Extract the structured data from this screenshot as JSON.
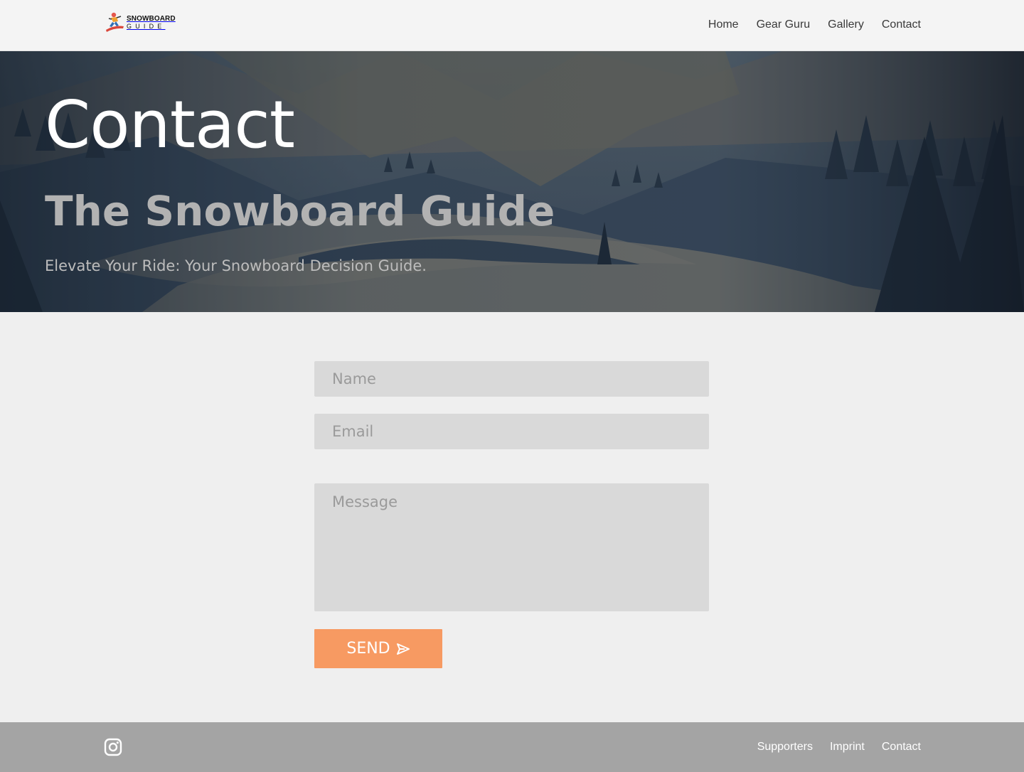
{
  "header": {
    "logo": {
      "line1": "SNOWBOARD",
      "line2": "GUIDE"
    },
    "nav": [
      {
        "label": "Home"
      },
      {
        "label": "Gear Guru"
      },
      {
        "label": "Gallery"
      },
      {
        "label": "Contact"
      }
    ]
  },
  "hero": {
    "title": "Contact",
    "subtitle": "The Snowboard Guide",
    "tagline": "Elevate Your Ride: Your Snowboard Decision Guide."
  },
  "form": {
    "name_placeholder": "Name",
    "email_placeholder": "Email",
    "message_placeholder": "Message",
    "send_label": "SEND"
  },
  "footer": {
    "social_icon": "instagram-icon",
    "links": [
      {
        "label": "Supporters"
      },
      {
        "label": "Imprint"
      },
      {
        "label": "Contact"
      }
    ]
  },
  "colors": {
    "accent": "#f79a62",
    "header_bg": "#f4f4f4",
    "page_bg": "#efefef",
    "field_bg": "#d9d9d9",
    "footer_bg": "#a4a4a4"
  }
}
